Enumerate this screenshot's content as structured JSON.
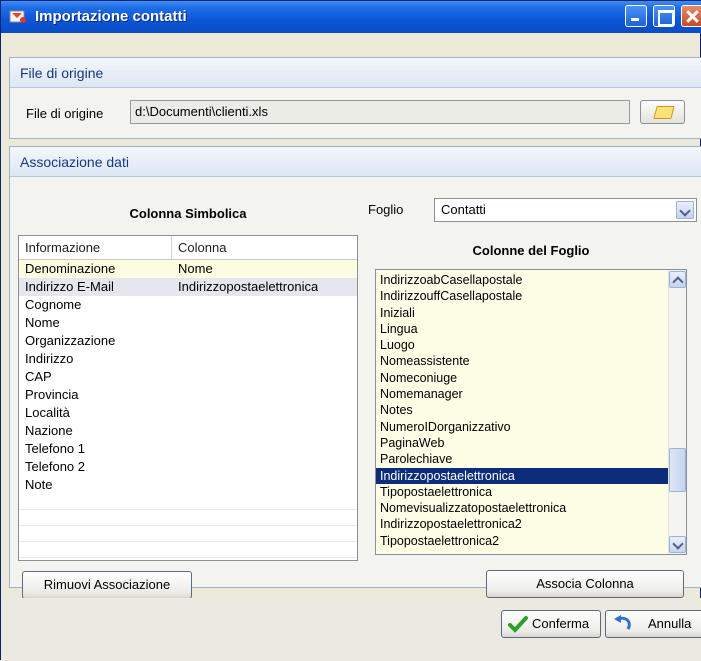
{
  "window": {
    "title": "Importazione contatti"
  },
  "source_panel": {
    "header": "File di origine",
    "file_label": "File di origine",
    "file_value": "d:\\Documenti\\clienti.xls"
  },
  "mapping_panel": {
    "header": "Associazione dati",
    "symbolic_title": "Colonna Simbolica",
    "columns": [
      "Informazione",
      "Colonna"
    ],
    "rows": [
      [
        "Denominazione",
        "Nome"
      ],
      [
        "Indirizzo E-Mail",
        "Indirizzopostaelettronica"
      ],
      [
        "Cognome",
        ""
      ],
      [
        "Nome",
        ""
      ],
      [
        "Organizzazione",
        ""
      ],
      [
        "Indirizzo",
        ""
      ],
      [
        "CAP",
        ""
      ],
      [
        "Provincia",
        ""
      ],
      [
        "Località",
        ""
      ],
      [
        "Nazione",
        ""
      ],
      [
        "Telefono 1",
        ""
      ],
      [
        "Telefono 2",
        ""
      ],
      [
        "Note",
        ""
      ]
    ],
    "sheet_label": "Foglio",
    "sheet_value": "Contatti",
    "sheet_columns_title": "Colonne del Foglio",
    "sheet_columns": [
      "IndirizzoabCasellapostale",
      "IndirizzouffCasellapostale",
      "Iniziali",
      "Lingua",
      "Luogo",
      "Nomeassistente",
      "Nomeconiuge",
      "Nomemanager",
      "Notes",
      "NumeroIDorganizzativo",
      "PaginaWeb",
      "Parolechiave",
      "Indirizzopostaelettronica",
      "Tipopostaelettronica",
      "Nomevisualizzatopostaelettronica",
      "Indirizzopostaelettronica2",
      "Tipopostaelettronica2"
    ],
    "selected_sheet_column": "Indirizzopostaelettronica",
    "remove_button": "Rimuovi Associazione",
    "associate_button": "Associa Colonna"
  },
  "footer": {
    "confirm_button": "Conferma",
    "cancel_button": "Annulla"
  },
  "colors": {
    "title_bar": "#0b56d8",
    "selection": "#0b2d7a",
    "list_bg": "#fefde6"
  }
}
